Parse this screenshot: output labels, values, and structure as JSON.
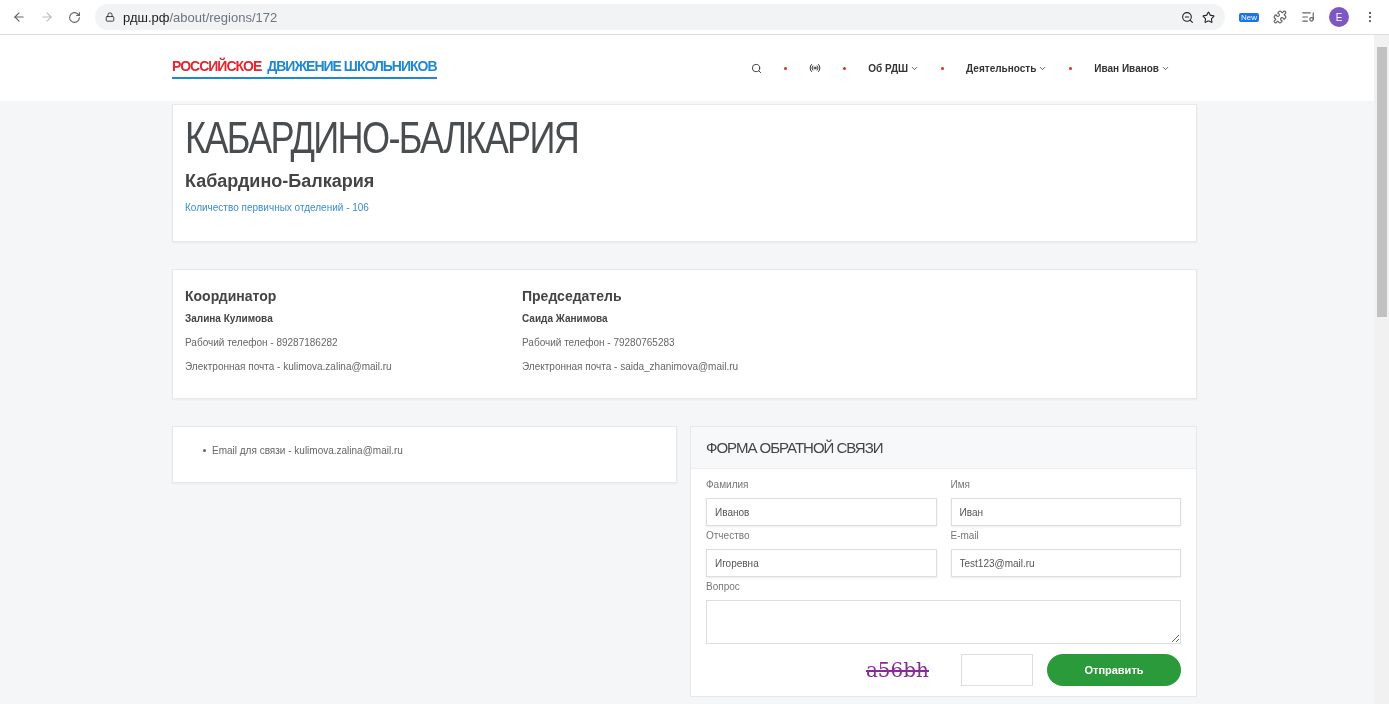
{
  "browser": {
    "url_host": "рдш.рф",
    "url_path": "/about/regions/172",
    "profile_initial": "E",
    "extension_badge": "New"
  },
  "header": {
    "logo": [
      {
        "text": "РОССИЙСКОЕ",
        "color": "#e3262f"
      },
      {
        "text": "ДВИЖЕНИЕ ШКОЛЬНИКОВ",
        "color": "#1e88d4"
      }
    ],
    "nav": [
      {
        "kind": "search"
      },
      {
        "kind": "antenna"
      },
      {
        "kind": "dropdown",
        "label": "Об РДШ"
      },
      {
        "kind": "dropdown",
        "label": "Деятельность"
      },
      {
        "kind": "dropdown",
        "label": "Иван Иванов"
      }
    ]
  },
  "region": {
    "title": "КАБАРДИНО-БАЛКАРИЯ",
    "subtitle": "Кабардино-Балкария",
    "branches": "Количество первичных отделений - 106"
  },
  "contacts": [
    {
      "role": "Координатор",
      "name": "Залина Кулимова",
      "phone": "Рабочий телефон - 89287186282",
      "email": "Электронная почта - kulimova.zalina@mail.ru"
    },
    {
      "role": "Председатель",
      "name": "Саида Жанимова",
      "phone": "Рабочий телефон - 79280765283",
      "email": "Электронная почта - saida_zhanimova@mail.ru"
    }
  ],
  "info": [
    "Email для связи - kulimova.zalina@mail.ru"
  ],
  "form": {
    "title": "ФОРМА ОБРАТНОЙ СВЯЗИ",
    "fields": [
      {
        "label": "Фамилия",
        "value": "Иванов"
      },
      {
        "label": "Имя",
        "value": "Иван"
      },
      {
        "label": "Отчество",
        "value": "Игоревна"
      },
      {
        "label": "E-mail",
        "value": "Test123@mail.ru"
      }
    ],
    "question_label": "Вопрос",
    "captcha": "a56bh",
    "submit": "Отправить"
  }
}
